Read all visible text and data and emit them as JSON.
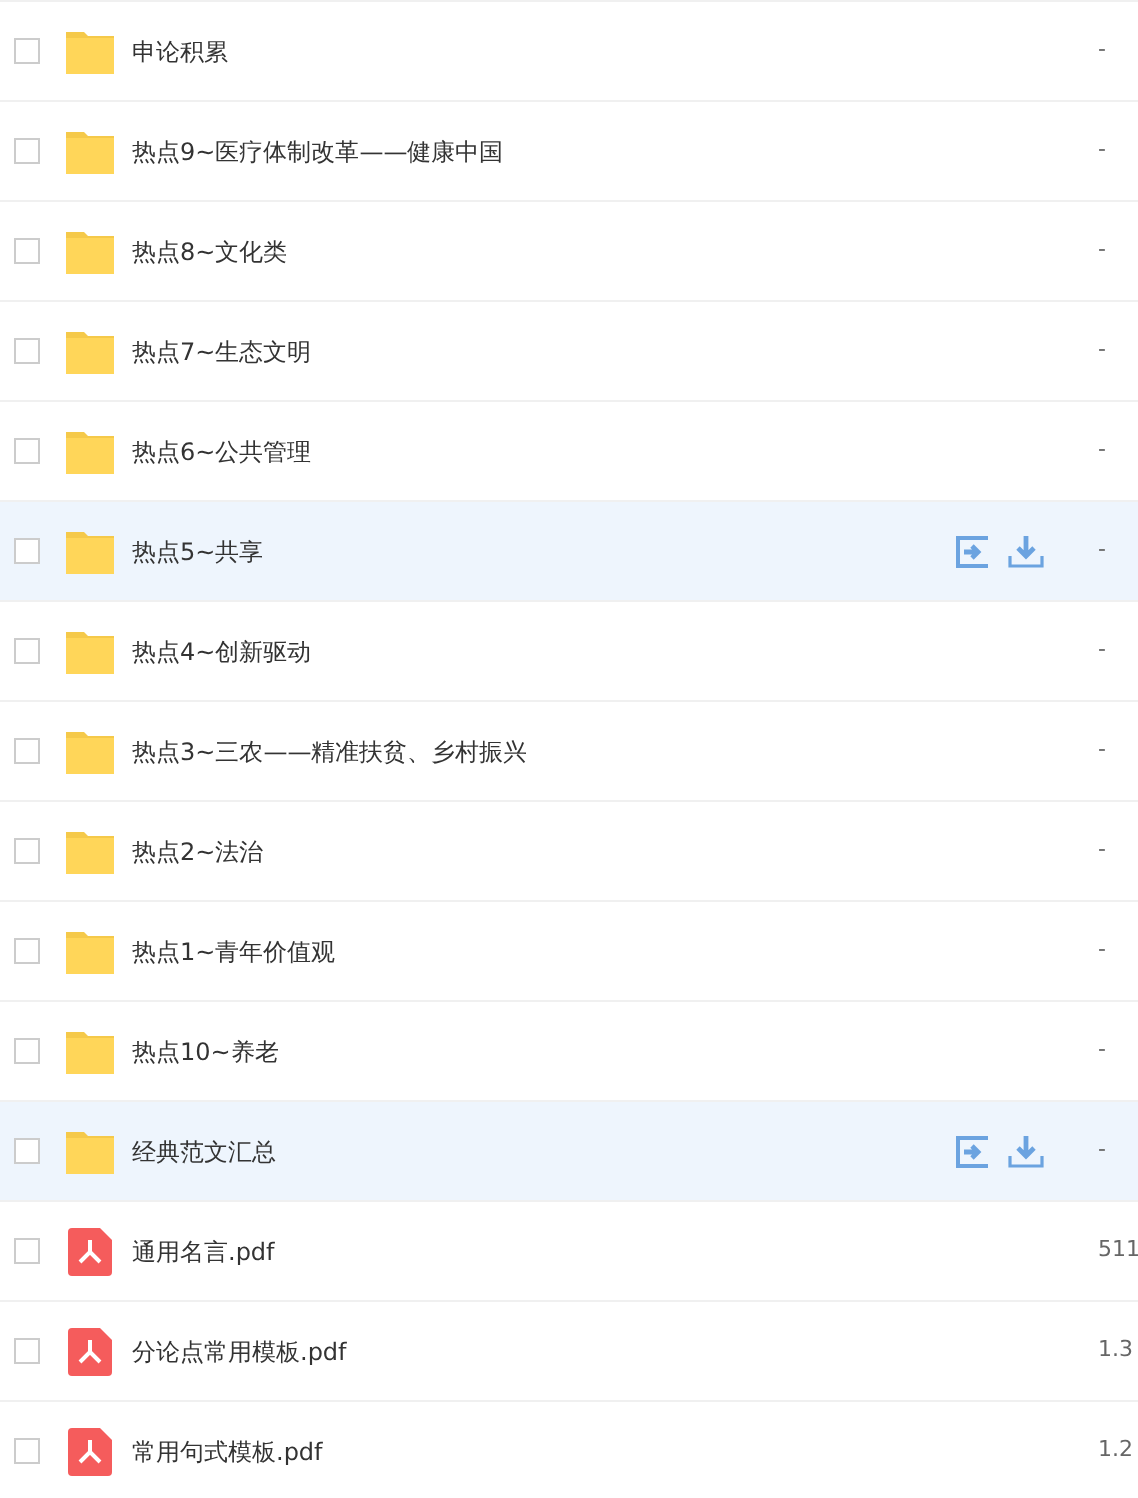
{
  "files": [
    {
      "kind": "folder",
      "name": "申论积累",
      "size": "-",
      "checked": false,
      "hovered": false
    },
    {
      "kind": "folder",
      "name": "热点9~医疗体制改革——健康中国",
      "size": "-",
      "checked": false,
      "hovered": false
    },
    {
      "kind": "folder",
      "name": "热点8~文化类",
      "size": "-",
      "checked": false,
      "hovered": false
    },
    {
      "kind": "folder",
      "name": "热点7~生态文明",
      "size": "-",
      "checked": false,
      "hovered": false
    },
    {
      "kind": "folder",
      "name": "热点6~公共管理",
      "size": "-",
      "checked": false,
      "hovered": false
    },
    {
      "kind": "folder",
      "name": "热点5~共享",
      "size": "-",
      "checked": false,
      "hovered": true
    },
    {
      "kind": "folder",
      "name": "热点4~创新驱动",
      "size": "-",
      "checked": false,
      "hovered": false
    },
    {
      "kind": "folder",
      "name": "热点3~三农——精准扶贫、乡村振兴",
      "size": "-",
      "checked": false,
      "hovered": false
    },
    {
      "kind": "folder",
      "name": "热点2~法治",
      "size": "-",
      "checked": false,
      "hovered": false
    },
    {
      "kind": "folder",
      "name": "热点1~青年价值观",
      "size": "-",
      "checked": false,
      "hovered": false
    },
    {
      "kind": "folder",
      "name": "热点10~养老",
      "size": "-",
      "checked": false,
      "hovered": false
    },
    {
      "kind": "folder",
      "name": "经典范文汇总",
      "size": "-",
      "checked": false,
      "hovered": true
    },
    {
      "kind": "pdf",
      "name": "通用名言.pdf",
      "size": "511",
      "checked": false,
      "hovered": false
    },
    {
      "kind": "pdf",
      "name": "分论点常用模板.pdf",
      "size": "1.3",
      "checked": false,
      "hovered": false
    },
    {
      "kind": "pdf",
      "name": "常用句式模板.pdf",
      "size": "1.2",
      "checked": false,
      "hovered": false
    }
  ]
}
